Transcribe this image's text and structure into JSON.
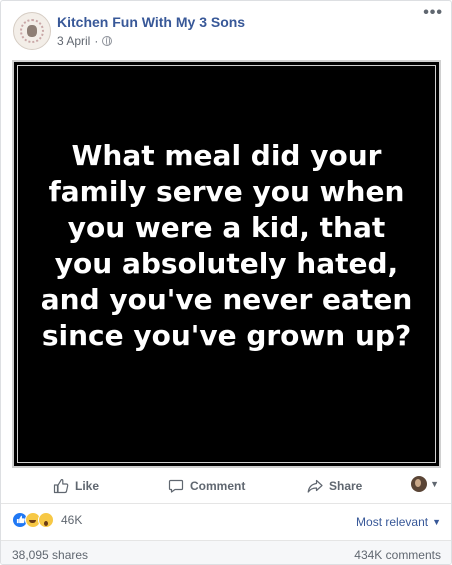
{
  "post": {
    "page_name": "Kitchen Fun With My 3 Sons",
    "date": "3 April",
    "separator": "·",
    "privacy_icon": "globe-icon",
    "more_icon": "ellipsis-icon",
    "more_label": "•••"
  },
  "image": {
    "background": "#000000",
    "text_color": "#ffffff",
    "quote": "What meal did your family serve you when you were a kid, that you absolutely hated, and you've never eaten since you've grown up?"
  },
  "actions": {
    "like_label": "Like",
    "comment_label": "Comment",
    "share_label": "Share"
  },
  "reactions": {
    "icons": [
      "like-reaction-icon",
      "haha-reaction-icon",
      "wow-reaction-icon"
    ],
    "count": "46K",
    "sort_label": "Most relevant"
  },
  "footer": {
    "shares": "38,095 shares",
    "comments": "434K comments"
  },
  "colors": {
    "link_blue": "#385898",
    "meta_gray": "#616770",
    "like_blue": "#2078f4"
  }
}
